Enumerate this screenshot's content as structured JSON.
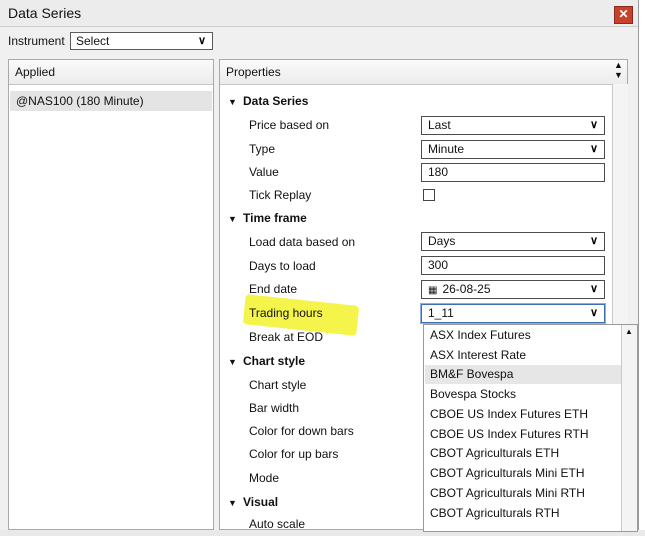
{
  "window": {
    "title": "Data Series",
    "close_glyph": "✕"
  },
  "instrument": {
    "label": "Instrument",
    "selected": "Select"
  },
  "applied": {
    "header": "Applied",
    "items": [
      "@NAS100 (180 Minute)"
    ]
  },
  "properties": {
    "header": "Properties",
    "categories": {
      "data_series": "Data Series",
      "time_frame": "Time frame",
      "chart_style": "Chart style",
      "visual": "Visual"
    },
    "rows": {
      "price_based_on": {
        "label": "Price based on",
        "value": "Last"
      },
      "type": {
        "label": "Type",
        "value": "Minute"
      },
      "value": {
        "label": "Value",
        "value": "180"
      },
      "tick_replay": {
        "label": "Tick Replay",
        "checked": false
      },
      "load_data_based_on": {
        "label": "Load data based on",
        "value": "Days"
      },
      "days_to_load": {
        "label": "Days to load",
        "value": "300"
      },
      "end_date": {
        "label": "End date",
        "value": "26-08-25"
      },
      "trading_hours": {
        "label": "Trading hours",
        "value": "1_11"
      },
      "break_at_eod": {
        "label": "Break at EOD"
      },
      "chart_style": {
        "label": "Chart style"
      },
      "bar_width": {
        "label": "Bar width"
      },
      "color_down": {
        "label": "Color for down bars"
      },
      "color_up": {
        "label": "Color for up bars"
      },
      "mode": {
        "label": "Mode"
      },
      "auto_scale": {
        "label": "Auto scale"
      }
    }
  },
  "trading_hours_options": [
    "ASX Index Futures",
    "ASX Interest Rate",
    "BM&F Bovespa",
    "Bovespa Stocks",
    "CBOE US Index Futures ETH",
    "CBOE US Index Futures RTH",
    "CBOT Agriculturals ETH",
    "CBOT Agriculturals Mini ETH",
    "CBOT Agriculturals Mini RTH",
    "CBOT Agriculturals RTH"
  ],
  "trading_hours_hovered": "BM&F Bovespa",
  "colors": {
    "highlight": "#f2f22a",
    "close": "#c8412b",
    "focus": "#3d6fb5"
  }
}
